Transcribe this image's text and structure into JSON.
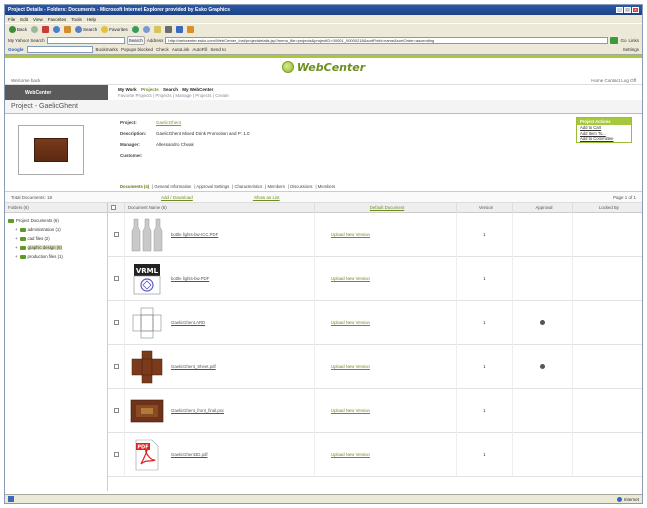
{
  "window": {
    "title": "Project Details - Folders: Documents - Microsoft Internet Explorer provided by Esko Graphics"
  },
  "menu": [
    "File",
    "Edit",
    "View",
    "Favorites",
    "Tools",
    "Help"
  ],
  "toolbar": {
    "back": "Back",
    "search": "Search",
    "favorites": "Favorites"
  },
  "address": {
    "my_yahoo_label": "My Yahoo! Search",
    "search_btn": "Search",
    "label": "Address",
    "url": "http://webcenter.esko.com/WebCenter_Inst/projectdetails.jsp?menu_file=projects&projectID=00001_00000218&sortField=name&sortOrder=ascending",
    "go": "Go",
    "links": "Links"
  },
  "google_bar": {
    "label": "Google",
    "bookmarks": "Bookmarks",
    "popups": "Popups blocked",
    "check": "Check",
    "autolink": "AutoLink",
    "autofill": "AutoFill",
    "send_to": "Send to",
    "settings": "Settings"
  },
  "brand": {
    "name": "WebCenter"
  },
  "top_util": {
    "left": "Welcome back",
    "right": "Home   Contact   Log Off"
  },
  "nav": {
    "tab": "WebCenter",
    "main_links": [
      "My Work",
      "Projects",
      "Search",
      "My WebCenter"
    ],
    "sub_links": "Favorite Projects | Projects | Manage | Projects | Create"
  },
  "page_title": "Project - GaelicGhent",
  "project": {
    "fields": [
      {
        "label": "Project:",
        "value": "GaelicGhent",
        "link": true
      },
      {
        "label": "Description:",
        "value": "GaelicGhent Mixed Drink Promotion and P: 1.0",
        "link": false
      },
      {
        "label": "Manager:",
        "value": "Allessandro Cheak",
        "link": false
      },
      {
        "label": "Customer:",
        "value": "",
        "link": false
      }
    ],
    "actions_title": "Project Actions",
    "actions": [
      "Add to Cart",
      "Add Item To...",
      "Add to Committee"
    ],
    "subtabs": [
      "Documents (4)",
      "General Information",
      "Approval Settings",
      "Characteristics",
      "Members",
      "Discussions",
      "Members"
    ]
  },
  "docbar": {
    "total": "Total Documents: 18",
    "link1": "Add / Download",
    "link2": "Show as List",
    "paging": "Page 1 of 1"
  },
  "tree": {
    "header": "Folders (6)",
    "root": "Project Documents (6)",
    "items": [
      {
        "label": "administration (1)",
        "selected": false
      },
      {
        "label": "cad files (2)",
        "selected": false
      },
      {
        "label": "graphic design (6)",
        "selected": true
      },
      {
        "label": "production files (1)",
        "selected": false
      }
    ]
  },
  "table": {
    "headers": {
      "document": "Document Name (6)",
      "action": "Default Document",
      "version": "Version",
      "approval": "Approval",
      "locked": "Locked By"
    },
    "rows": [
      {
        "name": "bottle lights-bw-ICC.PDF",
        "action": "Upload New Version",
        "version": "1",
        "approved": false,
        "thumb": "bottles"
      },
      {
        "name": "bottle lights-bw.PDF",
        "action": "Upload New Version",
        "version": "1",
        "approved": false,
        "thumb": "vrml"
      },
      {
        "name": "GaelicGhent.ARD",
        "action": "Upload New Version",
        "version": "1",
        "approved": true,
        "thumb": "cad"
      },
      {
        "name": "GaelicGhent_Sheet.pdf",
        "action": "Upload New Version",
        "version": "1",
        "approved": true,
        "thumb": "diecut"
      },
      {
        "name": "GaelicGhent_front_final.psc",
        "action": "Upload New Version",
        "version": "1",
        "approved": false,
        "thumb": "box"
      },
      {
        "name": "GaelicGhent3D.pdf",
        "action": "Upload New Version",
        "version": "1",
        "approved": false,
        "thumb": "pdf"
      }
    ]
  },
  "status": {
    "zone": "Internet"
  }
}
